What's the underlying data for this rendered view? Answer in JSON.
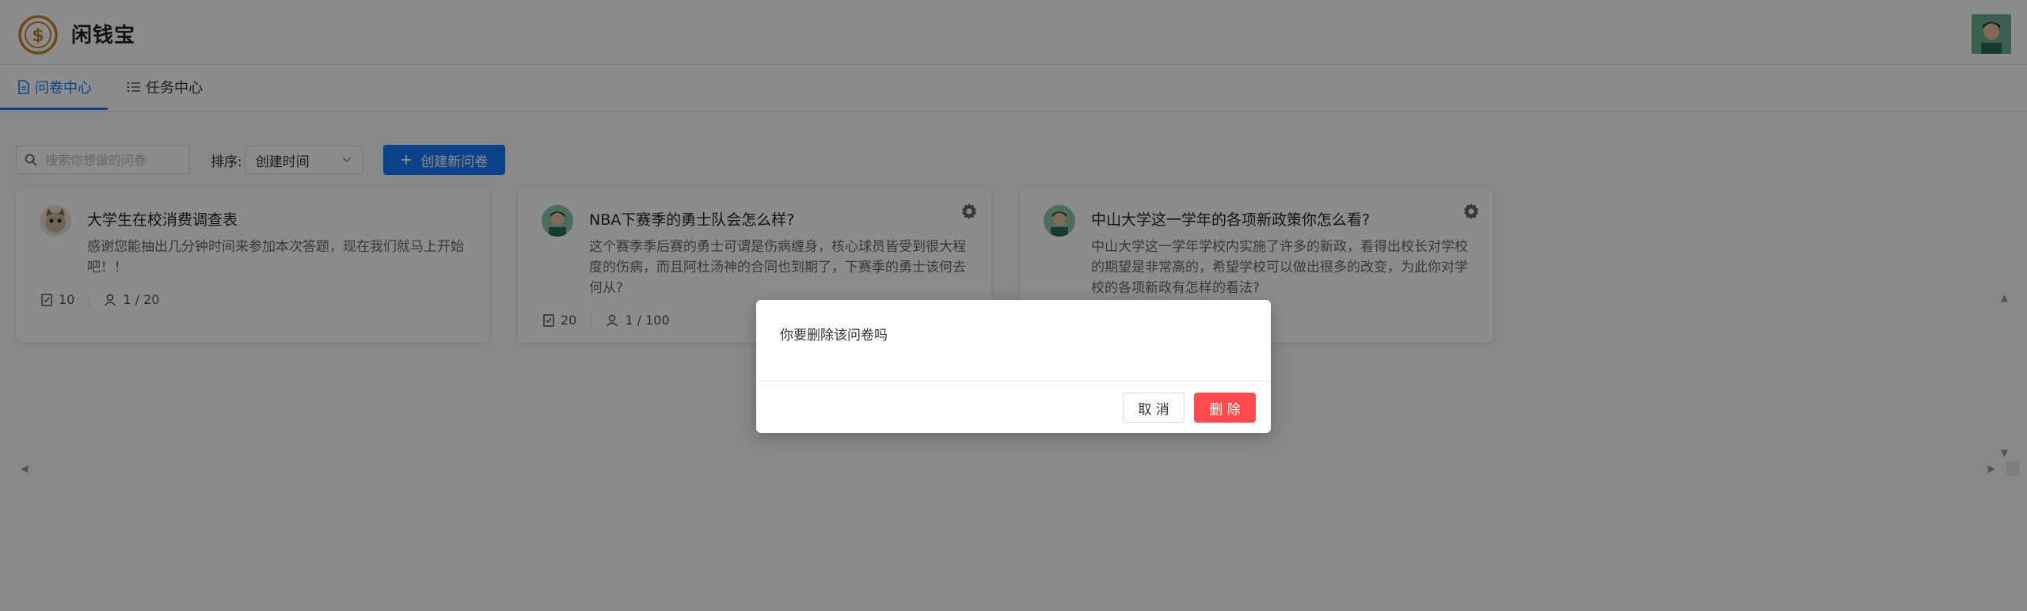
{
  "app": {
    "brand": "闲钱宝"
  },
  "tabs": [
    {
      "label": "问卷中心",
      "icon": "file-icon",
      "active": true
    },
    {
      "label": "任务中心",
      "icon": "list-icon",
      "active": false
    }
  ],
  "toolbar": {
    "search_placeholder": "搜索你想做的问卷",
    "sort_label": "排序:",
    "sort_value": "创建时间",
    "create_label": "创建新问卷"
  },
  "cards": [
    {
      "title": "大学生在校消费调查表",
      "desc": "感谢您能抽出几分钟时间来参加本次答题，现在我们就马上开始吧！！",
      "questions": "10",
      "participants": "1 / 20",
      "avatar_icon": "cat-avatar-icon",
      "has_settings": false
    },
    {
      "title": "NBA下赛季的勇士队会怎么样?",
      "desc": "这个赛季季后赛的勇士可谓是伤病缠身，核心球员皆受到很大程度的伤病，而且阿杜汤神的合同也到期了，下赛季的勇士该何去何从?",
      "questions": "20",
      "participants": "1 / 100",
      "avatar_icon": "person-avatar-icon",
      "has_settings": true
    },
    {
      "title": "中山大学这一学年的各项新政策你怎么看?",
      "desc": "中山大学这一学年学校内实施了许多的新政，看得出校长对学校的期望是非常高的，希望学校可以做出很多的改变，为此你对学校的各项新政有怎样的看法?",
      "questions": "",
      "participants": "",
      "avatar_icon": "person-avatar-icon",
      "has_settings": true
    }
  ],
  "modal": {
    "message": "你要删除该问卷吗",
    "cancel_label": "取 消",
    "delete_label": "删 除"
  },
  "colors": {
    "primary": "#1677ff",
    "danger": "#ff4d4f",
    "brand_gold": "#c8862a"
  }
}
